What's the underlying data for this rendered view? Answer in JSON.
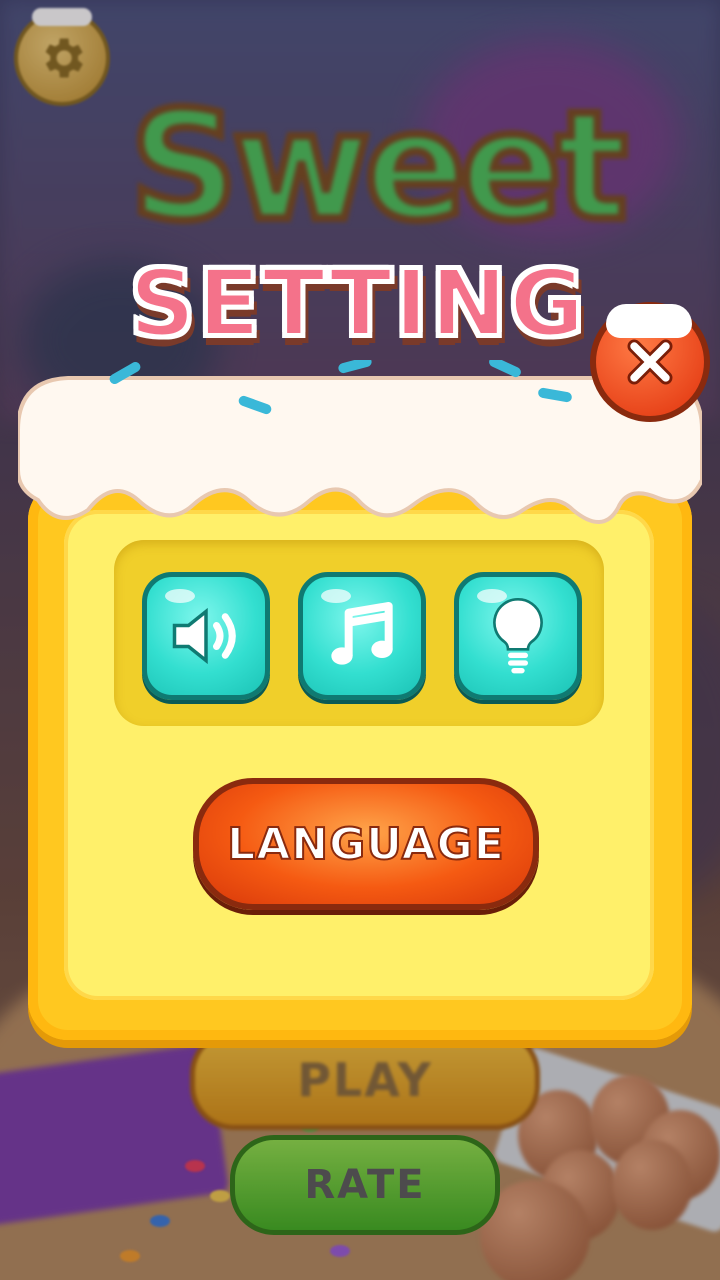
{
  "app": {
    "logo_text": "Sweet"
  },
  "dialog": {
    "title": "SETTING",
    "close_icon": "close-icon",
    "icons": [
      "speaker-icon",
      "music-note-icon",
      "lightbulb-icon"
    ],
    "language_label": "LANGUAGE"
  },
  "menu": {
    "play_label": "PLAY",
    "rate_label": "RATE",
    "settings_icon": "gear-icon"
  },
  "colors": {
    "title_pink": "#f4728a",
    "cake_yellow": "#ffc820",
    "icon_teal": "#33dfd0",
    "language_orange": "#f55a12",
    "rate_green": "#3fae1e",
    "play_gold": "#f7c23a"
  }
}
